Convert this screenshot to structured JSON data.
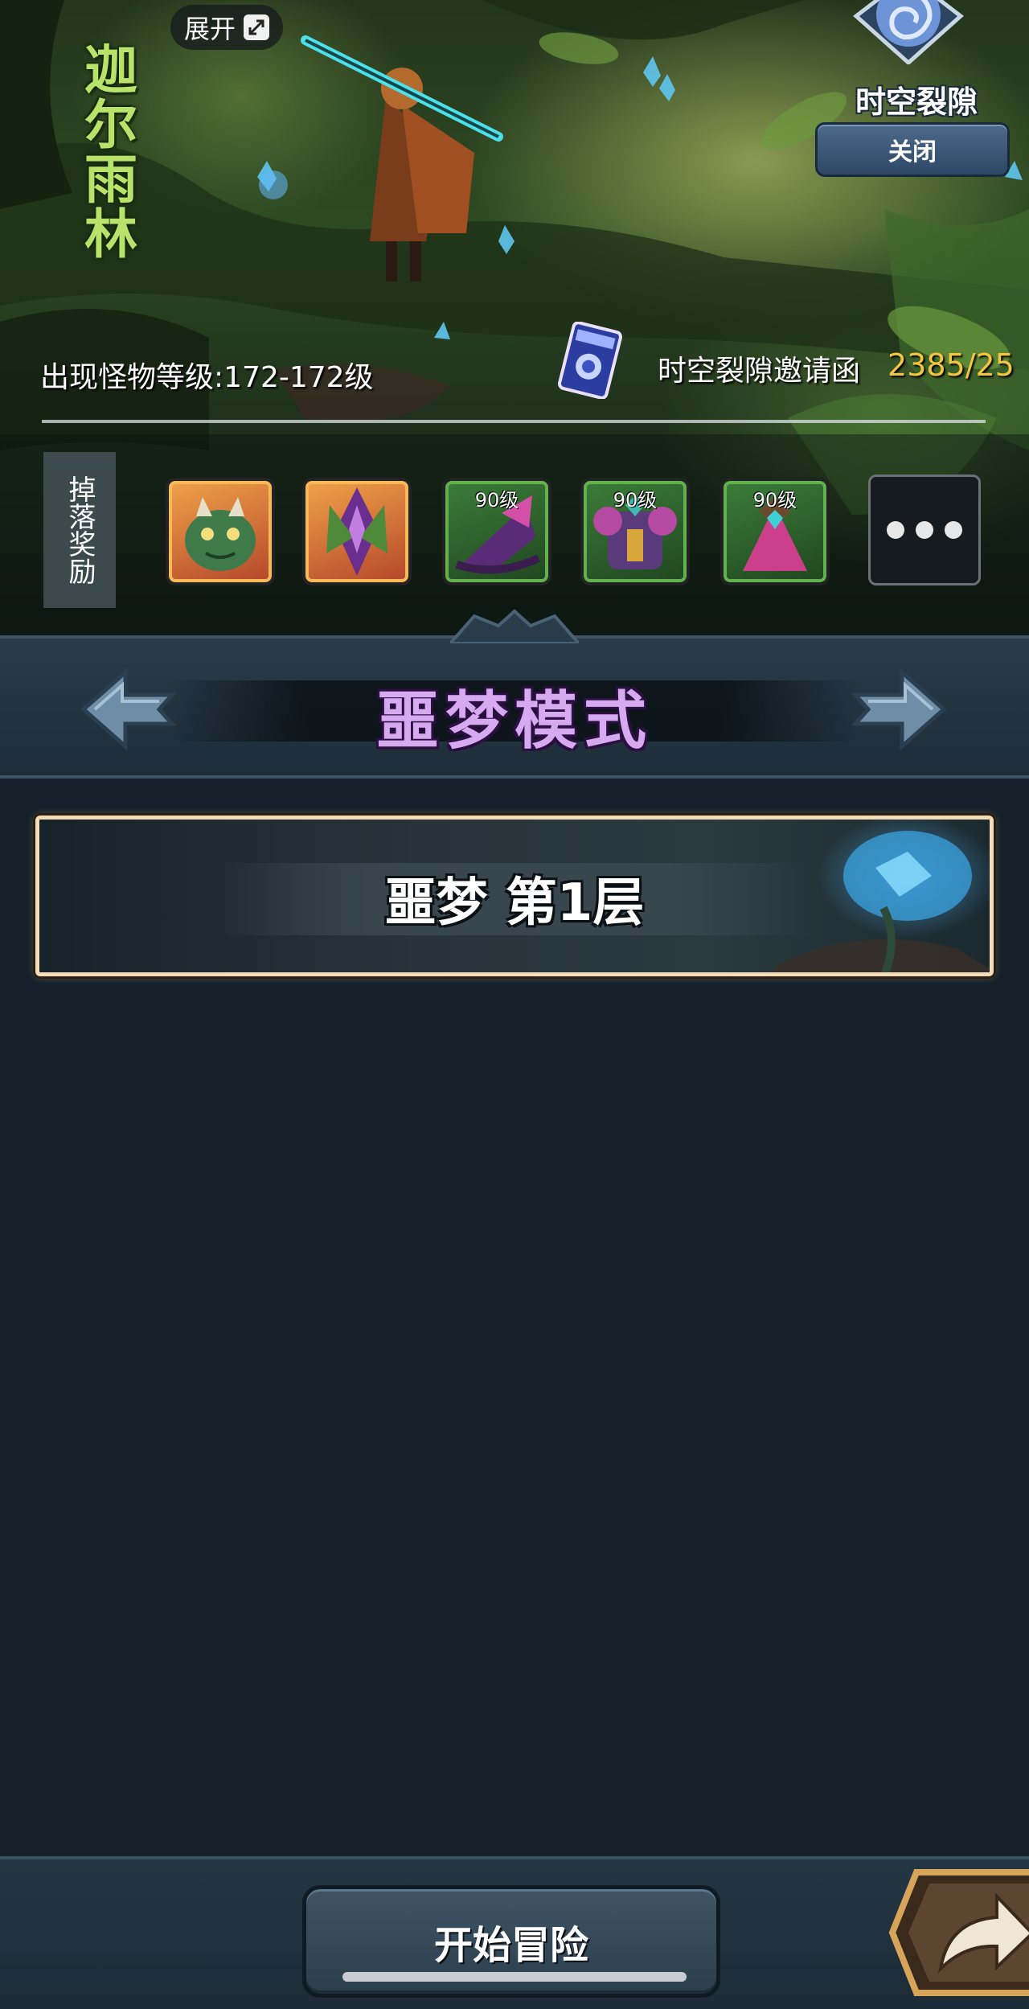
{
  "hero": {
    "zone_title": "迦尔雨林",
    "expand_label": "展开",
    "rift_title": "时空裂隙",
    "close_label": "关闭",
    "monster_level_text": "出现怪物等级:172-172级",
    "invite_label": "时空裂隙邀请函",
    "invite_count": "2385/25"
  },
  "drops": {
    "label": "掉落奖励",
    "items": [
      {
        "name": "green-dragon-pet",
        "level": "",
        "frame": "orange"
      },
      {
        "name": "purple-thorn-pet",
        "level": "",
        "frame": "orange"
      },
      {
        "name": "witch-hat",
        "level": "90级",
        "frame": "green"
      },
      {
        "name": "armor-chest",
        "level": "90级",
        "frame": "green"
      },
      {
        "name": "pink-cloak",
        "level": "90级",
        "frame": "green"
      }
    ]
  },
  "mode": {
    "title": "噩梦模式"
  },
  "floors": [
    {
      "label": "噩梦 第1层"
    }
  ],
  "footer": {
    "start_label": "开始冒险"
  },
  "colors": {
    "mode_title": "#d7a9f0",
    "invite_count": "#f4c542",
    "zone_title": "#b8e26a"
  }
}
